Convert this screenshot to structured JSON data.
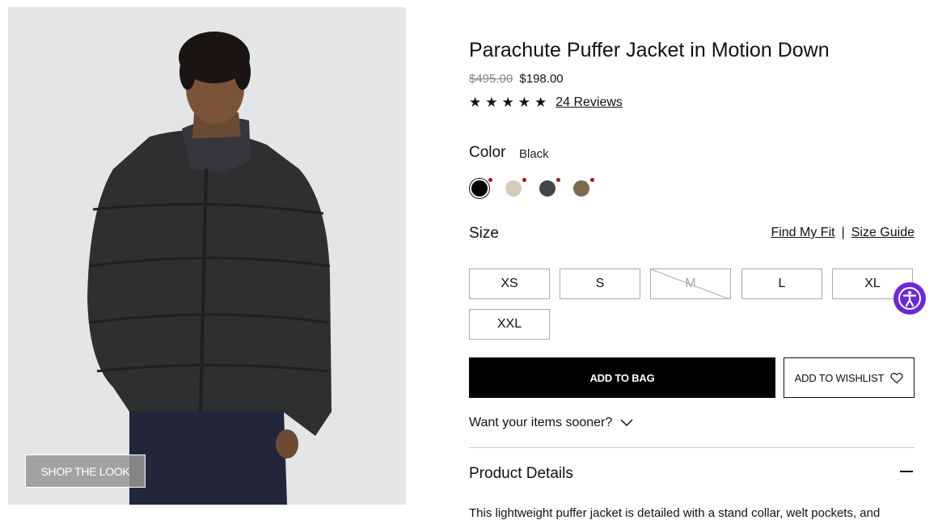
{
  "image": {
    "button_label": "SHOP THE LOOK"
  },
  "product": {
    "title": "Parachute Puffer Jacket in Motion Down",
    "old_price": "$495.00",
    "price": "$198.00",
    "rating_value": 4.5,
    "stars": "★★★★★",
    "reviews": "24 Reviews"
  },
  "color": {
    "label": "Color",
    "selected": "Black",
    "swatches": [
      {
        "name": "black",
        "hex": "#000000"
      },
      {
        "name": "beige",
        "hex": "#d6cbb9"
      },
      {
        "name": "charcoal",
        "hex": "#444444"
      },
      {
        "name": "olive",
        "hex": "#7a6a4e"
      }
    ]
  },
  "size": {
    "label": "Size",
    "find_fit": "Find My Fit",
    "separator": "|",
    "guide": "Size Guide",
    "options": [
      "XS",
      "S",
      "M",
      "L",
      "XL",
      "XXL"
    ],
    "unavailable": [
      "M"
    ]
  },
  "actions": {
    "add_to_bag": "ADD TO BAG",
    "add_to_wishlist": "ADD TO WISHLIST"
  },
  "delivery": {
    "label": "Want your items sooner?"
  },
  "details": {
    "title": "Product Details",
    "text": "This lightweight puffer jacket is detailed with a stand collar, welt pockets, and"
  }
}
